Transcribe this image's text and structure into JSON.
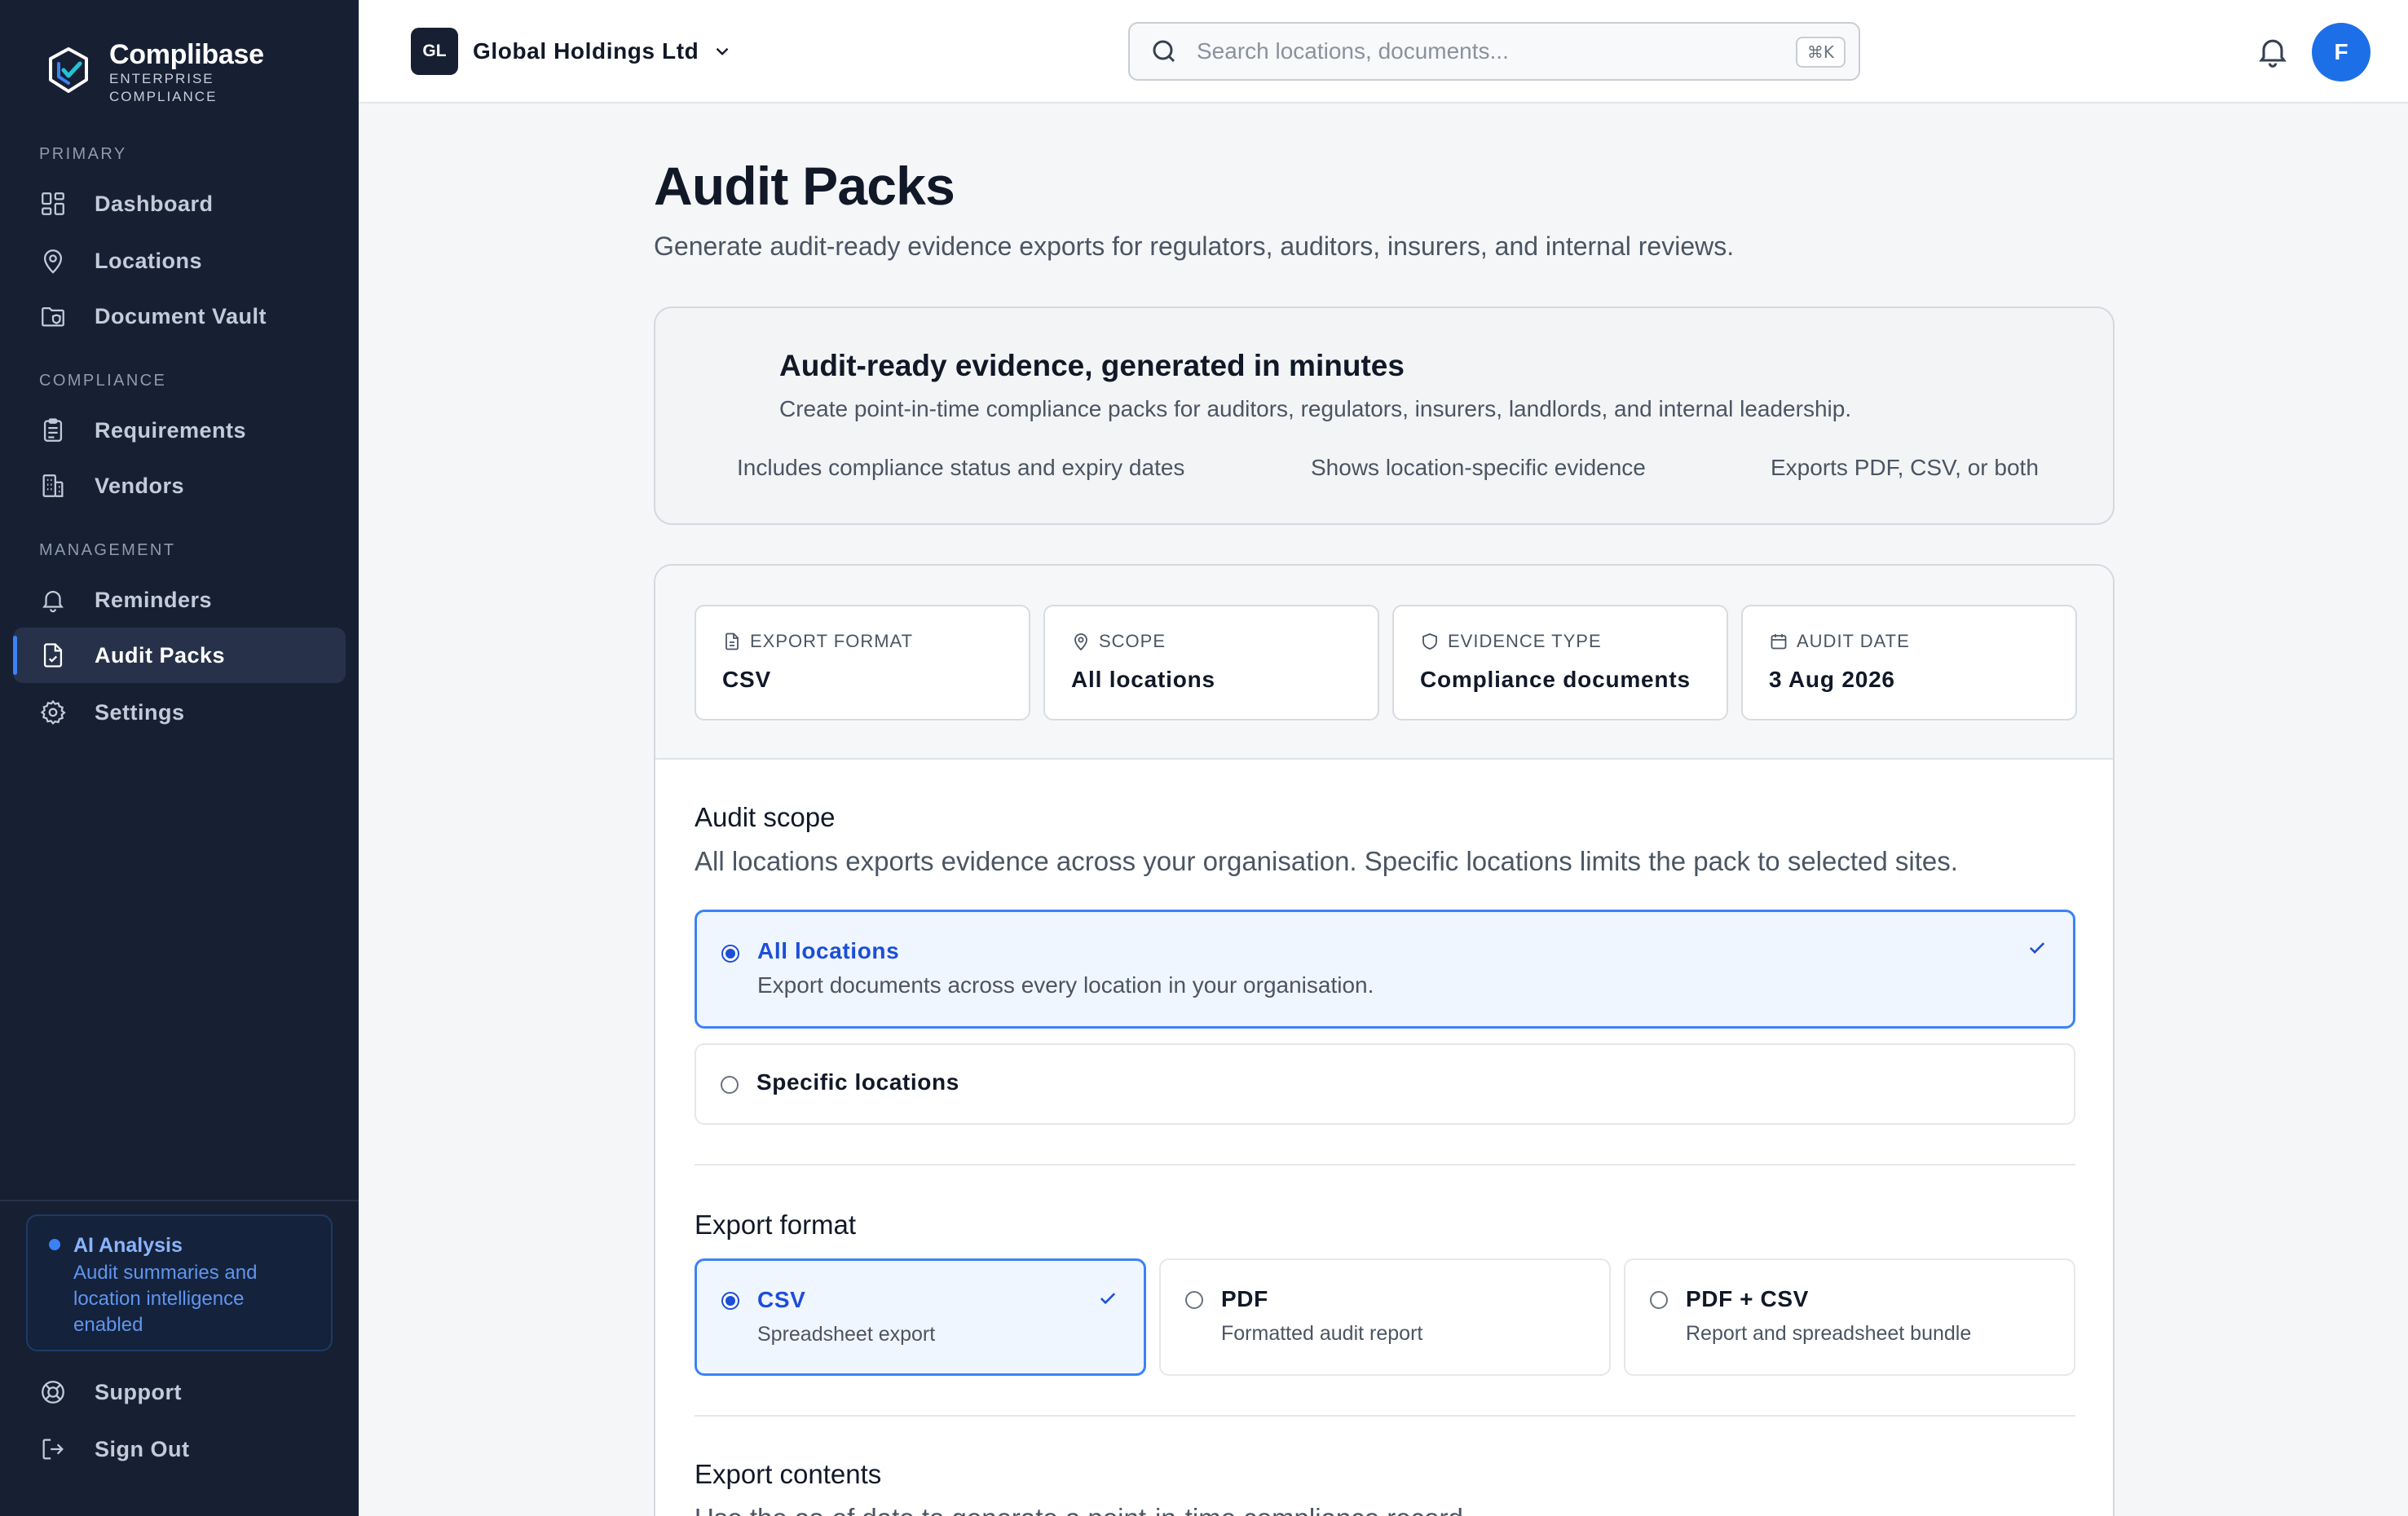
{
  "brand": {
    "name": "Complibase",
    "sub_line1": "ENTERPRISE",
    "sub_line2": "COMPLIANCE"
  },
  "sidebar": {
    "sections": {
      "primary": "PRIMARY",
      "compliance": "COMPLIANCE",
      "management": "MANAGEMENT"
    },
    "items": [
      {
        "label": "Dashboard",
        "icon": "grid-icon"
      },
      {
        "label": "Locations",
        "icon": "map-pin-icon"
      },
      {
        "label": "Document Vault",
        "icon": "folder-shield-icon"
      },
      {
        "label": "Requirements",
        "icon": "clipboard-icon"
      },
      {
        "label": "Vendors",
        "icon": "building-icon"
      },
      {
        "label": "Reminders",
        "icon": "bell-icon"
      },
      {
        "label": "Audit Packs",
        "icon": "file-check-icon",
        "active": true
      },
      {
        "label": "Settings",
        "icon": "gear-icon"
      }
    ],
    "ai_card": {
      "title": "AI Analysis",
      "desc": "Audit summaries and location intelligence enabled"
    },
    "footer_items": [
      {
        "label": "Support",
        "icon": "lifebuoy-icon"
      },
      {
        "label": "Sign Out",
        "icon": "sign-out-icon"
      }
    ]
  },
  "topbar": {
    "org_initials": "GL",
    "org_name": "Global Holdings Ltd",
    "search_placeholder": "Search locations, documents...",
    "search_shortcut": "⌘K",
    "avatar_initial": "F"
  },
  "page": {
    "title": "Audit Packs",
    "subtitle": "Generate audit-ready evidence exports for regulators, auditors, insurers, and internal reviews."
  },
  "hero": {
    "title": "Audit-ready evidence, generated in minutes",
    "desc": "Create point-in-time compliance packs for auditors, regulators, insurers, landlords, and internal leadership.",
    "features": [
      "Includes compliance status and expiry dates",
      "Shows location-specific evidence",
      "Exports PDF, CSV, or both"
    ]
  },
  "summary": [
    {
      "label": "EXPORT FORMAT",
      "value": "CSV",
      "icon": "file-icon"
    },
    {
      "label": "SCOPE",
      "value": "All locations",
      "icon": "map-pin-icon"
    },
    {
      "label": "EVIDENCE TYPE",
      "value": "Compliance documents",
      "icon": "shield-icon"
    },
    {
      "label": "AUDIT DATE",
      "value": "3 Aug 2026",
      "icon": "calendar-icon"
    }
  ],
  "audit_scope": {
    "title": "Audit scope",
    "desc": "All locations exports evidence across your organisation. Specific locations limits the pack to selected sites.",
    "options": [
      {
        "title": "All locations",
        "desc": "Export documents across every location in your organisation.",
        "selected": true
      },
      {
        "title": "Specific locations",
        "desc": "",
        "selected": false
      }
    ]
  },
  "export_format": {
    "title": "Export format",
    "options": [
      {
        "title": "CSV",
        "desc": "Spreadsheet export",
        "selected": true
      },
      {
        "title": "PDF",
        "desc": "Formatted audit report",
        "selected": false
      },
      {
        "title": "PDF + CSV",
        "desc": "Report and spreadsheet bundle",
        "selected": false
      }
    ]
  },
  "export_contents": {
    "title": "Export contents",
    "desc": "Use the as-of date to generate a point-in-time compliance record."
  },
  "colors": {
    "sidebar_bg": "#172033",
    "accent": "#3b82f6",
    "selected_bg": "#eff6ff",
    "selected_text": "#1d4ed8"
  }
}
